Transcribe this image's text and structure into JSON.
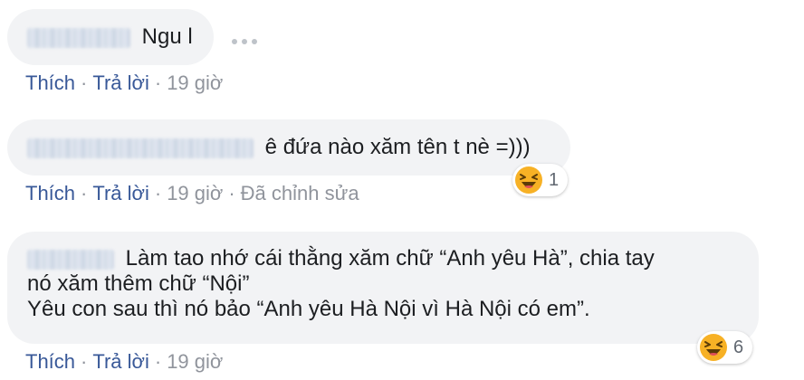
{
  "comments": [
    {
      "text": "Ngu l",
      "actions": {
        "like": "Thích",
        "reply": "Trả lời",
        "time": "19 giờ"
      }
    },
    {
      "text": "ê đứa nào xăm tên t nè =)))",
      "actions": {
        "like": "Thích",
        "reply": "Trả lời",
        "time": "19 giờ",
        "edited": "Đã chỉnh sửa"
      },
      "reaction": {
        "icon": "haha-icon",
        "count": "1"
      }
    },
    {
      "lines": [
        "Làm tao nhớ cái thằng xăm chữ “Anh yêu Hà”, chia tay",
        "nó xăm thêm chữ “Nội”",
        "Yêu con sau thì nó bảo “Anh yêu Hà Nội vì Hà Nội có em”."
      ],
      "actions": {
        "like": "Thích",
        "reply": "Trả lời",
        "time": "19 giờ"
      },
      "reaction": {
        "icon": "haha-icon",
        "count": "6"
      }
    }
  ],
  "colors": {
    "bubble": "#f2f3f5",
    "link": "#385898",
    "meta": "#90949c",
    "haha": "#f7b125"
  }
}
